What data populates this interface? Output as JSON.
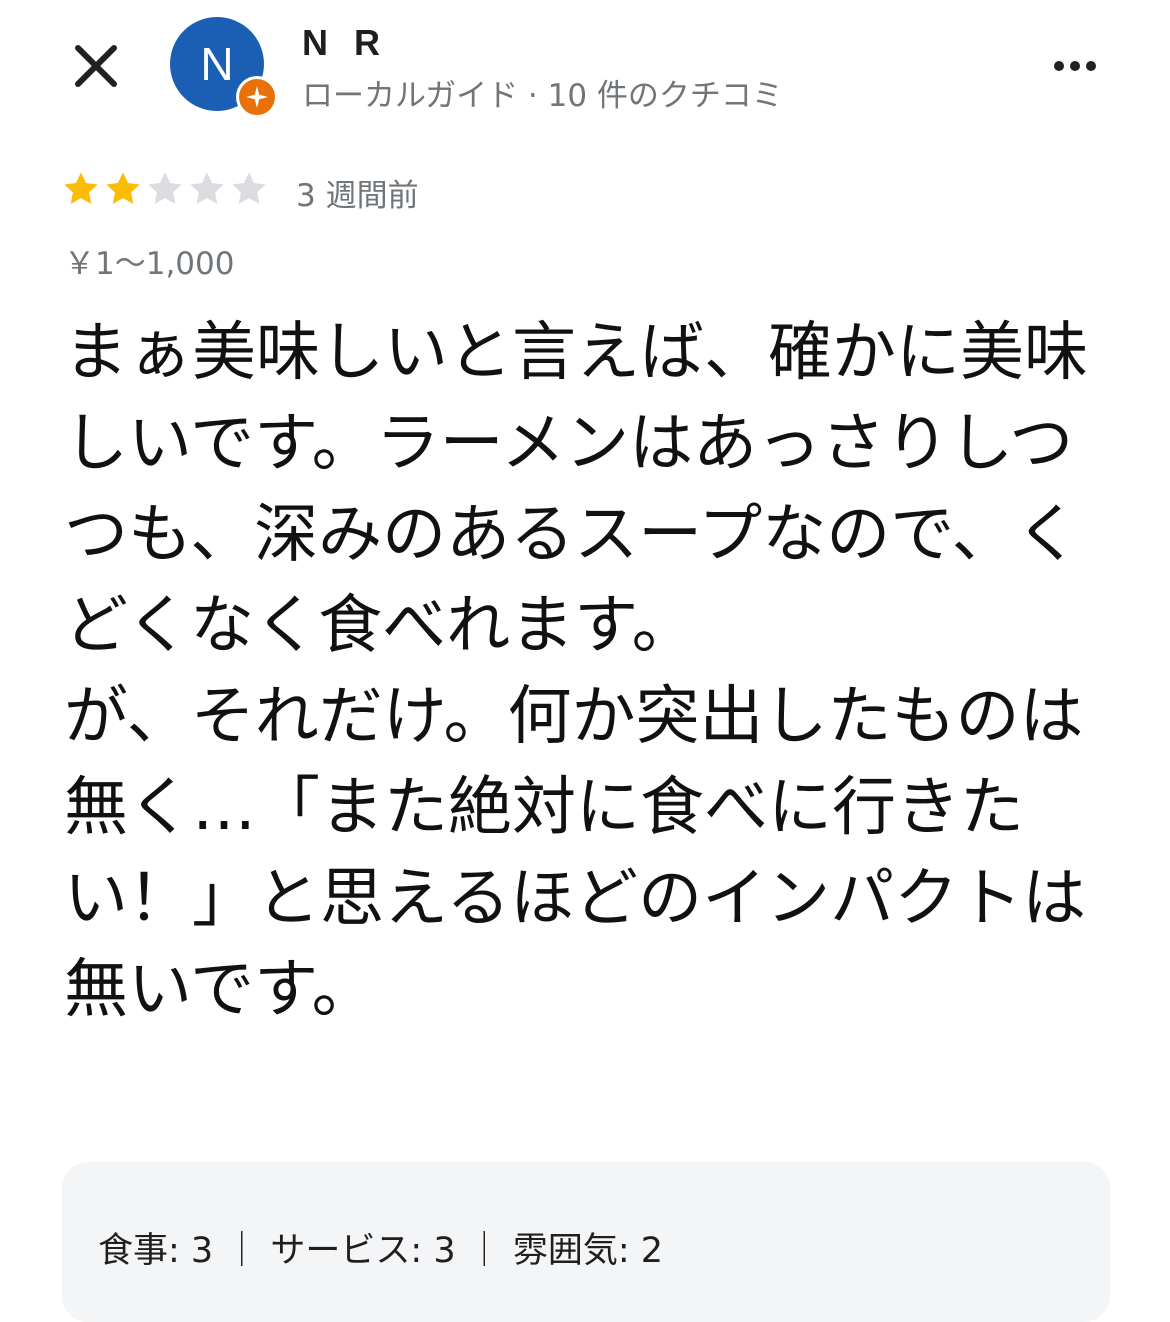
{
  "header": {
    "avatar_letter": "N",
    "user_name": "N R",
    "user_meta": "ローカルガイド · 10 件のクチコミ",
    "avatar_color": "#1a5fb4",
    "badge_color": "#e8710a"
  },
  "review": {
    "rating": 2,
    "rating_max": 5,
    "time_ago": "3 週間前",
    "price": "￥1～1,000",
    "text": "まぁ美味しいと言えば、確かに美味しいです。ラーメンはあっさりしつつも、深みのあるスープなので、くどくなく食べれます。\nが、それだけ。何か突出したものは無く…「また絶対に食べに行きたい！」と思えるほどのインパクトは無いです。",
    "attributes": "食事: 3 ｜ サービス: 3 ｜ 雰囲気: 2"
  },
  "colors": {
    "star_filled": "#fbbc04",
    "star_empty": "#dadce0"
  }
}
